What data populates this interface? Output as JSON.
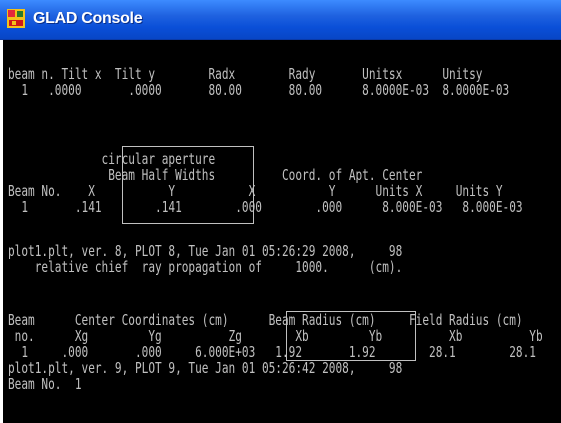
{
  "window": {
    "title": "GLAD Console",
    "icon": "glad-app-icon"
  },
  "console_lines": [
    "beam n. Tilt x  Tilt y        Radx        Rady       Unitsx      Unitsy",
    "  1   .0000       .0000       80.00       80.00      8.0000E-03  8.0000E-03",
    "              circular aperture",
    "               Beam Half Widths          Coord. of Apt. Center",
    "Beam No.    X           Y           X           Y      Units X     Units Y",
    "  1       .141        .141        .000        .000      8.000E-03   8.000E-03",
    "plot1.plt, ver. 8, PLOT 8, Tue Jan 01 05:26:29 2008,     98",
    "    relative chief  ray propagation of     1000.      (cm).",
    "Beam      Center Coordinates (cm)      Beam Radius (cm)     Field Radius (cm)",
    " no.      Xg         Yg          Zg        Xb         Yb          Xb          Yb",
    "  1     .000       .000     6.000E+03   1.92       1.92        28.1        28.1",
    "plot1.plt, ver. 9, PLOT 9, Tue Jan 01 05:26:42 2008,     98",
    "Beam No.  1"
  ]
}
